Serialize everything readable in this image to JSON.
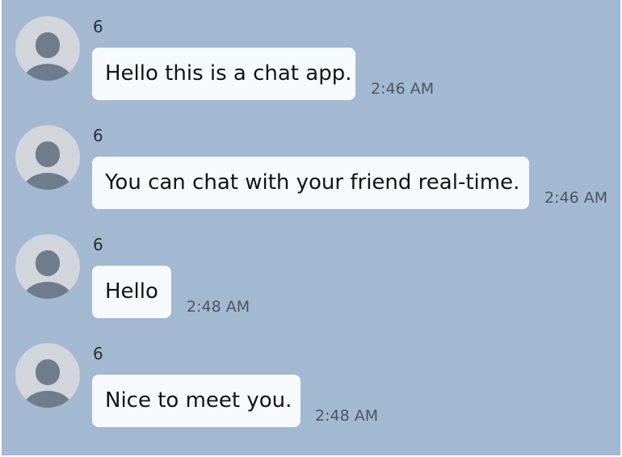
{
  "messages": [
    {
      "sender": "6",
      "text": "Hello this is a chat app.",
      "time": "2:46 AM"
    },
    {
      "sender": "6",
      "text": "You can chat with your friend real-time.",
      "time": "2:46 AM"
    },
    {
      "sender": "6",
      "text": "Hello",
      "time": "2:48 AM"
    },
    {
      "sender": "6",
      "text": "Nice to meet you.",
      "time": "2:48 AM"
    }
  ],
  "colors": {
    "background": "#a3b8d1",
    "bubble": "#f7fafc",
    "avatar_bg": "#d2d6dc",
    "avatar_fg": "#6e7c8c"
  },
  "icons": {
    "avatar": "user-silhouette-icon"
  }
}
